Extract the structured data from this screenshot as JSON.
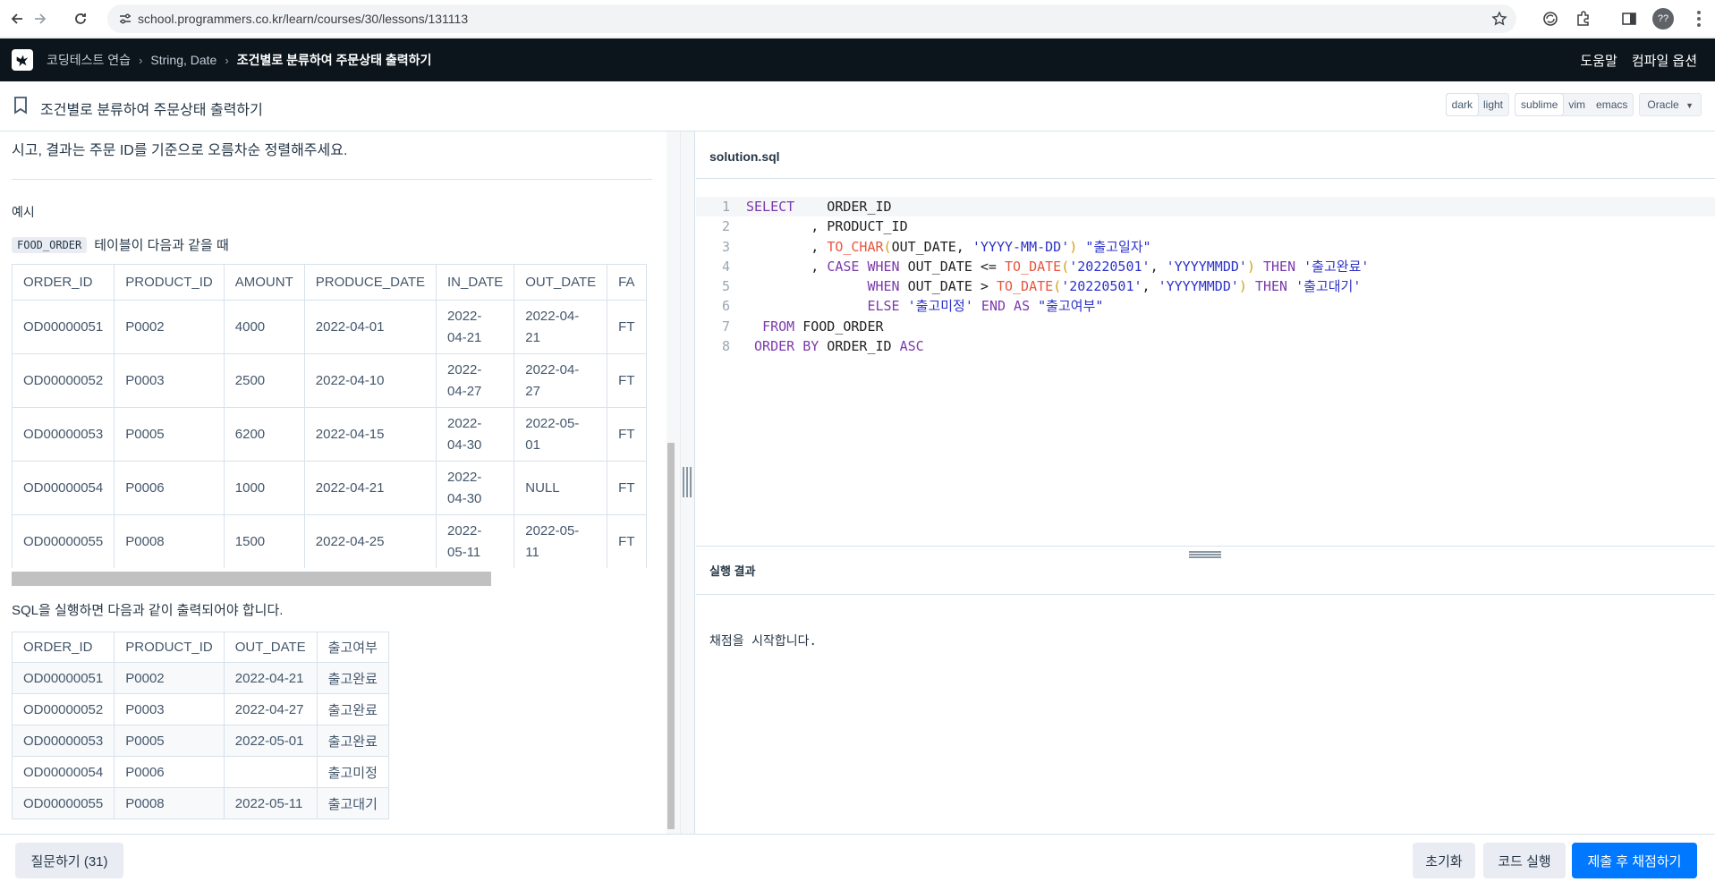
{
  "browser": {
    "url": "school.programmers.co.kr/learn/courses/30/lessons/131113",
    "profile_initial": "??"
  },
  "header": {
    "breadcrumbs": [
      "코딩테스트 연습",
      "String, Date",
      "조건별로 분류하여 주문상태 출력하기"
    ],
    "help_label": "도움말",
    "compile_options_label": "컴파일 옵션"
  },
  "subheader": {
    "title": "조건별로 분류하여 주문상태 출력하기",
    "theme_options": [
      "dark",
      "light"
    ],
    "keymap_options": [
      "sublime",
      "vim",
      "emacs"
    ],
    "language": "Oracle"
  },
  "description": {
    "top_text": "시고, 결과는 주문 ID를 기준으로 오름차순 정렬해주세요.",
    "example_label": "예시",
    "table_name": "FOOD_ORDER",
    "table_intro_suffix": "테이블이 다음과 같을 때",
    "result_intro": "SQL을 실행하면 다음과 같이 출력되어야 합니다."
  },
  "food_order_table": {
    "headers": [
      "ORDER_ID",
      "PRODUCT_ID",
      "AMOUNT",
      "PRODUCE_DATE",
      "IN_DATE",
      "OUT_DATE",
      "FA"
    ],
    "rows": [
      [
        "OD00000051",
        "P0002",
        "4000",
        "2022-04-01",
        "2022-\n04-21",
        "2022-04-\n21",
        "FT"
      ],
      [
        "OD00000052",
        "P0003",
        "2500",
        "2022-04-10",
        "2022-\n04-27",
        "2022-04-\n27",
        "FT"
      ],
      [
        "OD00000053",
        "P0005",
        "6200",
        "2022-04-15",
        "2022-\n04-30",
        "2022-05-\n01",
        "FT"
      ],
      [
        "OD00000054",
        "P0006",
        "1000",
        "2022-04-21",
        "2022-\n04-30",
        "NULL",
        "FT"
      ],
      [
        "OD00000055",
        "P0008",
        "1500",
        "2022-04-25",
        "2022-\n05-11",
        "2022-05-\n11",
        "FT"
      ]
    ]
  },
  "result_table": {
    "headers": [
      "ORDER_ID",
      "PRODUCT_ID",
      "OUT_DATE",
      "출고여부"
    ],
    "rows": [
      [
        "OD00000051",
        "P0002",
        "2022-04-21",
        "출고완료"
      ],
      [
        "OD00000052",
        "P0003",
        "2022-04-27",
        "출고완료"
      ],
      [
        "OD00000053",
        "P0005",
        "2022-05-01",
        "출고완료"
      ],
      [
        "OD00000054",
        "P0006",
        "",
        "출고미정"
      ],
      [
        "OD00000055",
        "P0008",
        "2022-05-11",
        "출고대기"
      ]
    ]
  },
  "editor": {
    "filename": "solution.sql",
    "lines": [
      [
        [
          "kw",
          "SELECT"
        ],
        [
          "t",
          "    ORDER_ID"
        ]
      ],
      [
        [
          "t",
          "        , PRODUCT_ID"
        ]
      ],
      [
        [
          "t",
          "        , "
        ],
        [
          "fn",
          "TO_CHAR"
        ],
        [
          "paren",
          "("
        ],
        [
          "t",
          "OUT_DATE, "
        ],
        [
          "str",
          "'YYYY-MM-DD'"
        ],
        [
          "paren",
          ")"
        ],
        [
          "t",
          " "
        ],
        [
          "str",
          "\"출고일자\""
        ]
      ],
      [
        [
          "t",
          "        , "
        ],
        [
          "kw",
          "CASE"
        ],
        [
          "t",
          " "
        ],
        [
          "kw",
          "WHEN"
        ],
        [
          "t",
          " OUT_DATE <= "
        ],
        [
          "fn",
          "TO_DATE"
        ],
        [
          "paren",
          "("
        ],
        [
          "str",
          "'20220501'"
        ],
        [
          "t",
          ", "
        ],
        [
          "str",
          "'YYYYMMDD'"
        ],
        [
          "paren",
          ")"
        ],
        [
          "t",
          " "
        ],
        [
          "kw",
          "THEN"
        ],
        [
          "t",
          " "
        ],
        [
          "str",
          "'출고완료'"
        ]
      ],
      [
        [
          "t",
          "               "
        ],
        [
          "kw",
          "WHEN"
        ],
        [
          "t",
          " OUT_DATE > "
        ],
        [
          "fn",
          "TO_DATE"
        ],
        [
          "paren",
          "("
        ],
        [
          "str",
          "'20220501'"
        ],
        [
          "t",
          ", "
        ],
        [
          "str",
          "'YYYYMMDD'"
        ],
        [
          "paren",
          ")"
        ],
        [
          "t",
          " "
        ],
        [
          "kw",
          "THEN"
        ],
        [
          "t",
          " "
        ],
        [
          "str",
          "'출고대기'"
        ]
      ],
      [
        [
          "t",
          "               "
        ],
        [
          "kw",
          "ELSE"
        ],
        [
          "t",
          " "
        ],
        [
          "str",
          "'출고미정'"
        ],
        [
          "t",
          " "
        ],
        [
          "kw",
          "END"
        ],
        [
          "t",
          " "
        ],
        [
          "kw",
          "AS"
        ],
        [
          "t",
          " "
        ],
        [
          "str",
          "\"출고여부\""
        ]
      ],
      [
        [
          "t",
          "  "
        ],
        [
          "kw",
          "FROM"
        ],
        [
          "t",
          " FOOD_ORDER"
        ]
      ],
      [
        [
          "t",
          " "
        ],
        [
          "kw",
          "ORDER BY"
        ],
        [
          "t",
          " ORDER_ID "
        ],
        [
          "kw",
          "ASC"
        ]
      ]
    ]
  },
  "result": {
    "title": "실행 결과",
    "message": "채점을 시작합니다."
  },
  "footer": {
    "ask_label": "질문하기 (31)",
    "reset_label": "초기화",
    "run_label": "코드 실행",
    "submit_label": "제출 후 채점하기"
  }
}
